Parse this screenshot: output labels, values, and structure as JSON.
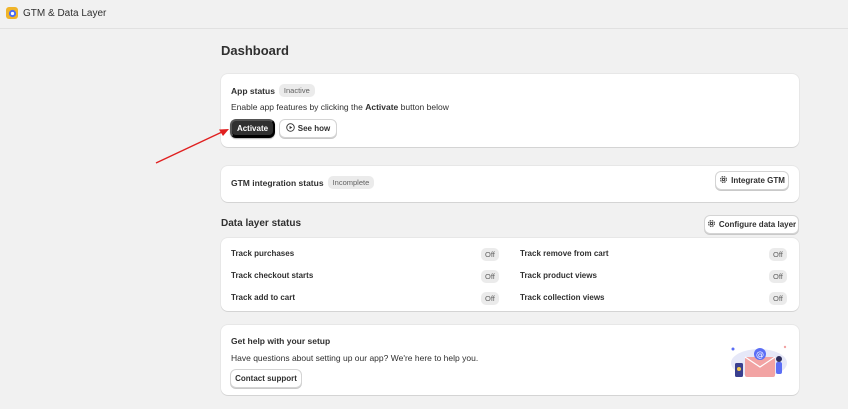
{
  "app": {
    "title": "GTM & Data Layer",
    "logo_icon": "app-logo-icon",
    "logo_color": "#f0b429"
  },
  "page": {
    "title": "Dashboard"
  },
  "app_status": {
    "label": "App status",
    "badge": "Inactive",
    "desc_prefix": "Enable app features by clicking the ",
    "desc_bold": "Activate",
    "desc_suffix": " button below",
    "activate_label": "Activate",
    "see_how_label": "See how"
  },
  "gtm": {
    "label": "GTM integration status",
    "badge": "Incomplete",
    "button_label": "Integrate GTM"
  },
  "data_layer": {
    "title": "Data layer status",
    "configure_label": "Configure data layer",
    "left": [
      {
        "label": "Track purchases",
        "status": "Off"
      },
      {
        "label": "Track checkout starts",
        "status": "Off"
      },
      {
        "label": "Track add to cart",
        "status": "Off"
      }
    ],
    "right": [
      {
        "label": "Track remove from cart",
        "status": "Off"
      },
      {
        "label": "Track product views",
        "status": "Off"
      },
      {
        "label": "Track collection views",
        "status": "Off"
      }
    ]
  },
  "help": {
    "title": "Get help with your setup",
    "desc": "Have questions about setting up our app? We're here to help you.",
    "button_label": "Contact support"
  },
  "colors": {
    "accent_dark": "#303030",
    "arrow": "#e02020",
    "background": "#f1f1f1"
  }
}
